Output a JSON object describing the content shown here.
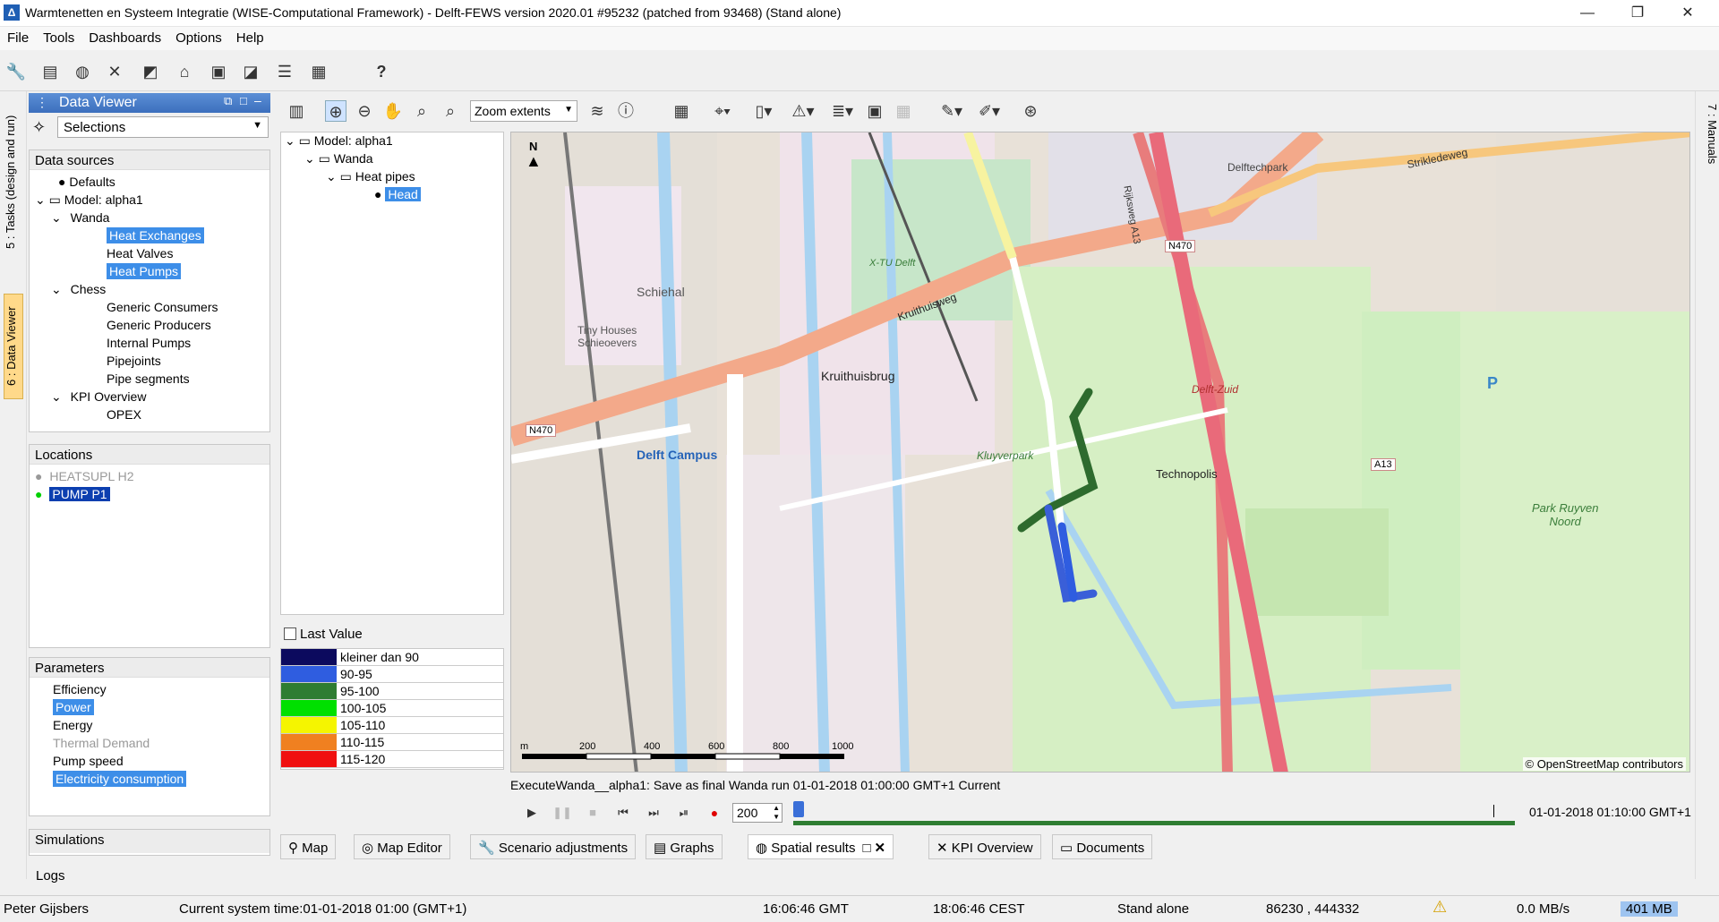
{
  "window": {
    "title": "Warmtenetten en Systeem Integratie (WISE-Computational Framework) - Delft-FEWS version 2020.01 #95232 (patched from 93468)  (Stand alone)"
  },
  "menu": {
    "file": "File",
    "tools": "Tools",
    "dashboards": "Dashboards",
    "options": "Options",
    "help": "Help"
  },
  "toolbar": {
    "help": "?"
  },
  "side_tabs": {
    "tasks": "5 : Tasks (design and run)",
    "data_viewer": "6 : Data Viewer",
    "manuals": "7 : Manuals"
  },
  "data_viewer": {
    "title": "Data Viewer",
    "selection": "Selections",
    "data_sources_label": "Data sources",
    "tree": [
      {
        "label": "Defaults"
      },
      {
        "label": "Model: alpha1"
      },
      {
        "label": "Wanda"
      },
      {
        "label": "Heat Exchanges"
      },
      {
        "label": "Heat Valves"
      },
      {
        "label": "Heat Pumps"
      },
      {
        "label": "Chess"
      },
      {
        "label": "Generic Consumers"
      },
      {
        "label": "Generic Producers"
      },
      {
        "label": "Internal Pumps"
      },
      {
        "label": "Pipejoints"
      },
      {
        "label": "Pipe segments"
      },
      {
        "label": "KPI Overview"
      },
      {
        "label": "OPEX"
      }
    ],
    "locations_label": "Locations",
    "locations": [
      {
        "label": "HEATSUPL H2"
      },
      {
        "label": "PUMP P1"
      }
    ],
    "parameters_label": "Parameters",
    "parameters": [
      {
        "label": "Efficiency"
      },
      {
        "label": "Power"
      },
      {
        "label": "Energy"
      },
      {
        "label": "Thermal Demand"
      },
      {
        "label": "Pump speed"
      },
      {
        "label": "Electricity consumption"
      }
    ],
    "simulations_label": "Simulations",
    "logs_label": "Logs"
  },
  "map_toolbar": {
    "zoom_select": "Zoom extents"
  },
  "result_tree": {
    "model": "Model: alpha1",
    "wanda": "Wanda",
    "heat_pipes": "Heat pipes",
    "head": "Head"
  },
  "legend": {
    "last_value_label": "Last Value",
    "items": [
      {
        "label": "kleiner dan 90",
        "color": "#0c0a5e"
      },
      {
        "label": "90-95",
        "color": "#2f5de0"
      },
      {
        "label": "95-100",
        "color": "#2e7d32"
      },
      {
        "label": "100-105",
        "color": "#00e000"
      },
      {
        "label": "105-110",
        "color": "#f5f500"
      },
      {
        "label": "110-115",
        "color": "#f08020"
      },
      {
        "label": "115-120",
        "color": "#f01010"
      }
    ]
  },
  "map": {
    "labels": {
      "schiehal": "Schiehal",
      "tiny_houses": "Tiny Houses\nSchieoevers",
      "kruithuisbrug": "Kruithuisbrug",
      "kruithuisweg": "Kruithuisweg",
      "delft_campus": "Delft Campus",
      "technopolis": "Technopolis",
      "kluyverpark": "Kluyverpark",
      "park_ruyven": "Park Ruyven\nNoord",
      "delftechpark": "Delftechpark",
      "n470": "N470",
      "a13": "A13",
      "delft_zuid": "Delft-Zuid",
      "rijksweg": "Rijksweg A13",
      "parking": "P",
      "x_tu_delft": "X-TU Delft",
      "strikledeweg": "Strikledeweg",
      "north": "N"
    },
    "scale": {
      "unit": "m",
      "ticks": [
        "200",
        "400",
        "600",
        "800",
        "1000"
      ]
    },
    "attribution": "© OpenStreetMap contributors"
  },
  "run": {
    "status": "ExecuteWanda__alpha1: Save as final Wanda run 01-01-2018 01:00:00 GMT+1 Current",
    "step": "200",
    "time": "01-01-2018 01:10:00 GMT+1"
  },
  "bottom_tabs": {
    "map": "Map",
    "map_editor": "Map Editor",
    "scenario": "Scenario adjustments",
    "graphs": "Graphs",
    "spatial": "Spatial results",
    "kpi": "KPI Overview",
    "documents": "Documents"
  },
  "status": {
    "user": "Peter Gijsbers",
    "system_time": "Current system time:01-01-2018 01:00 (GMT+1)",
    "gmt": "16:06:46 GMT",
    "cest": "18:06:46 CEST",
    "mode": "Stand alone",
    "coords": "86230 , 444332",
    "rate": "0.0 MB/s",
    "memory": "401 MB"
  }
}
